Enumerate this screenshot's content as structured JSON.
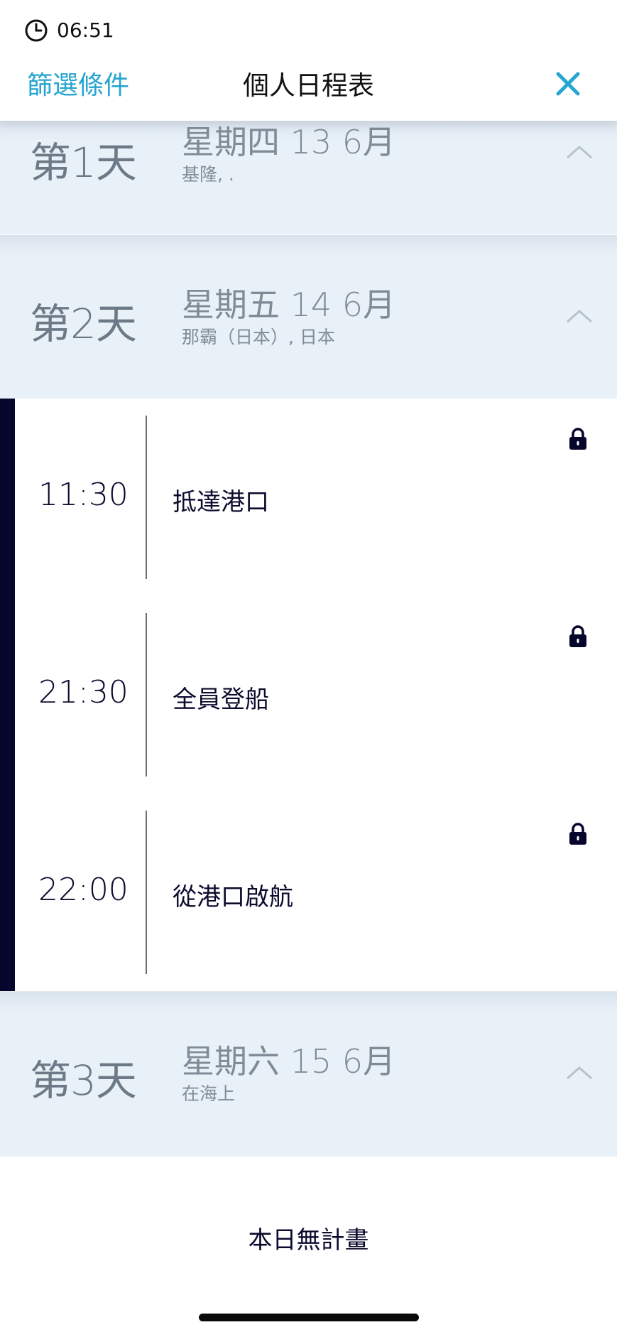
{
  "status": {
    "time": "06:51"
  },
  "header": {
    "filter_label": "篩選條件",
    "title": "個人日程表"
  },
  "days": [
    {
      "label": "第1天",
      "date": "星期四 13 6月",
      "location": "基隆, ."
    },
    {
      "label": "第2天",
      "date": "星期五 14 6月",
      "location": "那霸（日本）, 日本"
    },
    {
      "label": "第3天",
      "date": "星期六 15 6月",
      "location": "在海上"
    }
  ],
  "events": [
    {
      "time": "11:30",
      "title": "抵達港口"
    },
    {
      "time": "21:30",
      "title": "全員登船"
    },
    {
      "time": "22:00",
      "title": "從港口啟航"
    }
  ],
  "day3_empty_text": "本日無計畫",
  "colors": {
    "accent": "#25a5d0",
    "navy": "#06052b",
    "day_bg": "#e9f1f8"
  }
}
